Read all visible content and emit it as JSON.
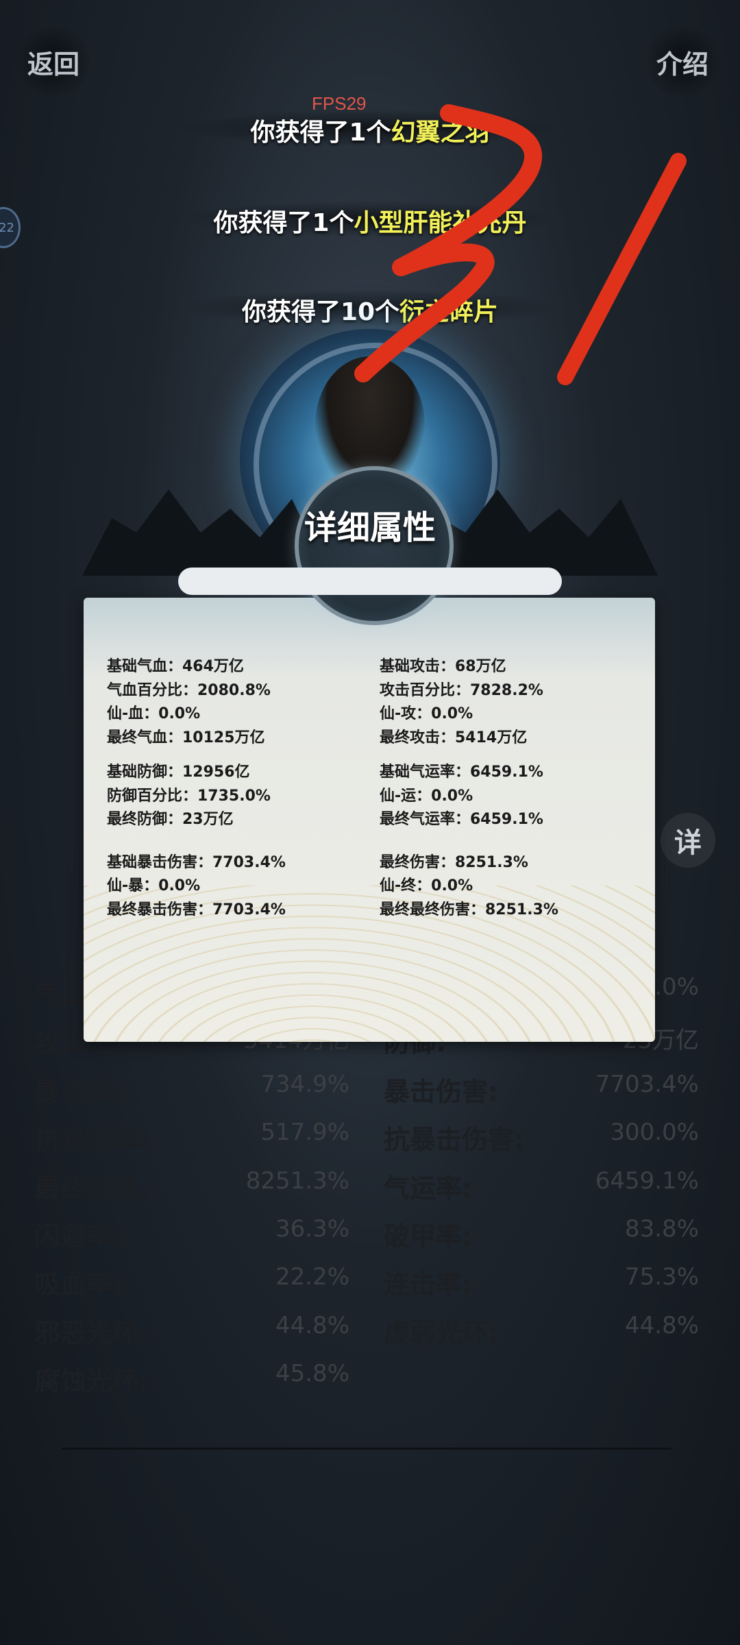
{
  "header": {
    "back_label": "返回",
    "intro_label": "介绍",
    "fps": "FPS29",
    "side_badge": "22"
  },
  "toasts": [
    {
      "prefix": "你获得了1个",
      "item": "幻翼之羽"
    },
    {
      "prefix": "你获得了1个",
      "item": "小型肝能补充丹"
    },
    {
      "prefix": "你获得了10个",
      "item": "衍之碎片"
    }
  ],
  "panel": {
    "title": "详细属性",
    "left_groups": [
      [
        "基础气血：464万亿",
        "气血百分比：2080.8%",
        "仙-血：0.0%",
        "最终气血：10125万亿"
      ],
      [
        "基础防御：12956亿",
        "防御百分比：1735.0%",
        "最终防御：23万亿"
      ],
      [
        "基础暴击伤害：7703.4%",
        "仙-暴：0.0%",
        "最终暴击伤害：7703.4%"
      ]
    ],
    "right_groups": [
      [
        "基础攻击：68万亿",
        "攻击百分比：7828.2%",
        "仙-攻：0.0%",
        "最终攻击：5414万亿"
      ],
      [
        "基础气运率：6459.1%",
        "仙-运：0.0%",
        "最终气运率：6459.1%"
      ],
      [
        "最终伤害：8251.3%",
        "仙-终：0.0%",
        "最终最终伤害：8251.3%"
      ]
    ]
  },
  "detail_button": "详",
  "stats": {
    "rows": [
      {
        "l_label": "气血:",
        "l_val": "",
        "r_label": "",
        "r_val": ".0%"
      },
      {
        "l_label": "攻击:",
        "l_val": "5414万亿",
        "r_label": "防御:",
        "r_val": "23万亿"
      },
      {
        "l_label": "暴击率:",
        "l_val": "734.9%",
        "r_label": "暴击伤害:",
        "r_val": "7703.4%"
      },
      {
        "l_label": "抗暴击率:",
        "l_val": "517.9%",
        "r_label": "抗暴击伤害:",
        "r_val": "300.0%"
      },
      {
        "l_label": "最终伤害:",
        "l_val": "8251.3%",
        "r_label": "气运率:",
        "r_val": "6459.1%"
      },
      {
        "l_label": "闪避率:",
        "l_val": "36.3%",
        "r_label": "破甲率:",
        "r_val": "83.8%"
      },
      {
        "l_label": "吸血率:",
        "l_val": "22.2%",
        "r_label": "连击率:",
        "r_val": "75.3%"
      },
      {
        "l_label": "邪恶光环:",
        "l_val": "44.8%",
        "r_label": "虚弱光环:",
        "r_val": "44.8%"
      },
      {
        "l_label": "腐蚀光环:",
        "l_val": "45.8%",
        "r_label": "",
        "r_val": ""
      }
    ]
  },
  "colors": {
    "item_highlight": "#f2f15a",
    "scribble": "#e0321a",
    "fps": "#e0574b"
  }
}
